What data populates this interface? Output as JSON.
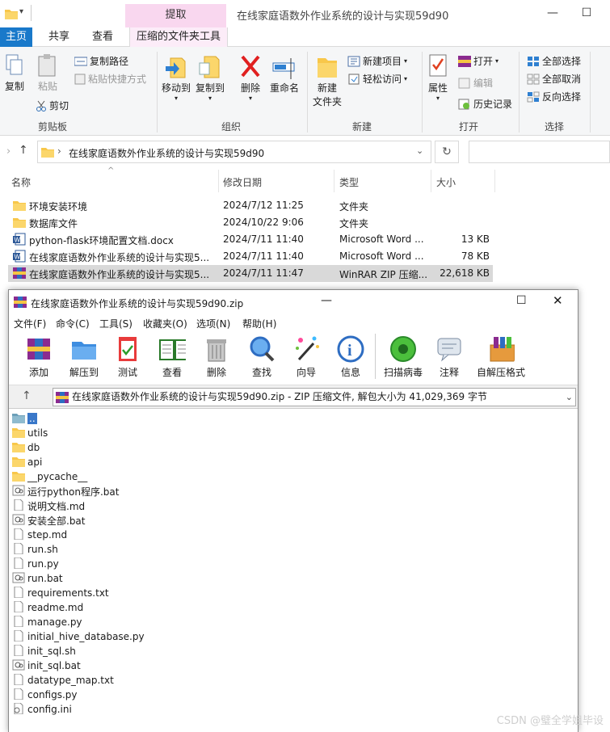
{
  "explorer": {
    "title": "在线家庭语数外作业系统的设计与实现59d90",
    "context_tab": "提取",
    "tabs": [
      "主页",
      "共享",
      "查看",
      "压缩的文件夹工具"
    ],
    "clipboard": {
      "copy": "复制",
      "paste": "粘贴",
      "copy_path": "复制路径",
      "paste_shortcut": "粘贴快捷方式",
      "cut": "剪切",
      "label": "剪贴板"
    },
    "organize": {
      "move_to": "移动到",
      "copy_to": "复制到",
      "delete": "删除",
      "rename": "重命名",
      "label": "组织"
    },
    "new": {
      "new_folder_l1": "新建",
      "new_folder_l2": "文件夹",
      "new_item": "新建项目",
      "easy_access": "轻松访问",
      "label": "新建"
    },
    "open": {
      "properties": "属性",
      "open": "打开",
      "edit": "编辑",
      "history": "历史记录",
      "label": "打开"
    },
    "select": {
      "select_all": "全部选择",
      "select_none": "全部取消",
      "invert": "反向选择",
      "label": "选择"
    },
    "address": "在线家庭语数外作业系统的设计与实现59d90",
    "columns": {
      "name": "名称",
      "modified": "修改日期",
      "type": "类型",
      "size": "大小"
    },
    "files": [
      {
        "name": "环境安装环境",
        "modified": "2024/7/12 11:25",
        "type": "文件夹",
        "size": "",
        "icon": "folder-icon"
      },
      {
        "name": "数据库文件",
        "modified": "2024/10/22 9:06",
        "type": "文件夹",
        "size": "",
        "icon": "folder-icon"
      },
      {
        "name": "python-flask环境配置文档.docx",
        "modified": "2024/7/11 11:40",
        "type": "Microsoft Word ...",
        "size": "13 KB",
        "icon": "word-icon"
      },
      {
        "name": "在线家庭语数外作业系统的设计与实现5...",
        "modified": "2024/7/11 11:40",
        "type": "Microsoft Word ...",
        "size": "78 KB",
        "icon": "word-icon"
      },
      {
        "name": "在线家庭语数外作业系统的设计与实现5...",
        "modified": "2024/7/11 11:47",
        "type": "WinRAR ZIP 压缩...",
        "size": "22,618 KB",
        "icon": "rar-icon"
      }
    ]
  },
  "winrar": {
    "title": "在线家庭语数外作业系统的设计与实现59d90.zip",
    "menu": [
      "文件(F)",
      "命令(C)",
      "工具(S)",
      "收藏夹(O)",
      "选项(N)",
      "帮助(H)"
    ],
    "toolbar": [
      "添加",
      "解压到",
      "测试",
      "查看",
      "删除",
      "查找",
      "向导",
      "信息",
      "扫描病毒",
      "注释",
      "自解压格式"
    ],
    "path": "在线家庭语数外作业系统的设计与实现59d90.zip - ZIP 压缩文件, 解包大小为 41,029,369 字节",
    "items": [
      {
        "name": "..",
        "icon": "parent-folder-icon"
      },
      {
        "name": "utils",
        "icon": "folder-icon"
      },
      {
        "name": "db",
        "icon": "folder-icon"
      },
      {
        "name": "api",
        "icon": "folder-icon"
      },
      {
        "name": "__pycache__",
        "icon": "folder-icon"
      },
      {
        "name": "运行python程序.bat",
        "icon": "bat-icon"
      },
      {
        "name": "说明文档.md",
        "icon": "file-icon"
      },
      {
        "name": "安装全部.bat",
        "icon": "bat-icon"
      },
      {
        "name": "step.md",
        "icon": "file-icon"
      },
      {
        "name": "run.sh",
        "icon": "file-icon"
      },
      {
        "name": "run.py",
        "icon": "file-icon"
      },
      {
        "name": "run.bat",
        "icon": "bat-icon"
      },
      {
        "name": "requirements.txt",
        "icon": "file-icon"
      },
      {
        "name": "readme.md",
        "icon": "file-icon"
      },
      {
        "name": "manage.py",
        "icon": "file-icon"
      },
      {
        "name": "initial_hive_database.py",
        "icon": "file-icon"
      },
      {
        "name": "init_sql.sh",
        "icon": "file-icon"
      },
      {
        "name": "init_sql.bat",
        "icon": "bat-icon"
      },
      {
        "name": "datatype_map.txt",
        "icon": "file-icon"
      },
      {
        "name": "configs.py",
        "icon": "file-icon"
      },
      {
        "name": "config.ini",
        "icon": "ini-icon"
      }
    ]
  },
  "watermark": "CSDN @璧全学姐毕设",
  "colors": {
    "accent": "#1979ca",
    "context": "#f9d7ef",
    "selected": "#d9d9d9",
    "folder": "#f8c74a"
  }
}
